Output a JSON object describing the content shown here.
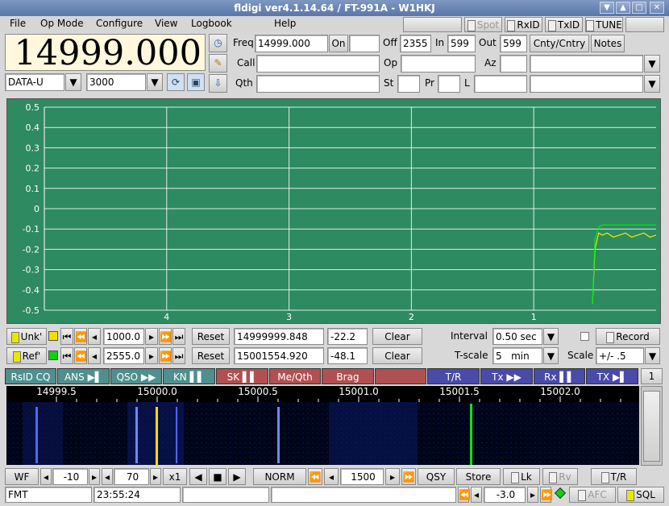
{
  "window": {
    "title": "fldigi ver4.1.14.64 / FT-991A - W1HKJ",
    "buttons": [
      "▼",
      "▲",
      "□",
      "✕"
    ]
  },
  "menu": [
    "File",
    "Op Mode",
    "Configure",
    "View",
    "Logbook",
    "Help"
  ],
  "status_buttons": {
    "spot": "Spot",
    "rxid": "RxID",
    "txid": "TxID",
    "tune": "TUNE"
  },
  "freq_display": "14999.000",
  "mode": "DATA-U",
  "bandwidth": "3000",
  "log": {
    "freq_label": "Freq",
    "freq": "14999.000",
    "on_label": "On",
    "on_value": "",
    "off_label": "Off",
    "off": "2355",
    "in_label": "In",
    "in": "599",
    "out_label": "Out",
    "out": "599",
    "cnty_label": "Cnty/Cntry",
    "notes_label": "Notes",
    "call_label": "Call",
    "call": "",
    "op_label": "Op",
    "op": "",
    "az_label": "Az",
    "az": "",
    "qth_label": "Qth",
    "qth": "",
    "st_label": "St",
    "st": "",
    "pr_label": "Pr",
    "pr": "",
    "l_label": "L",
    "l": ""
  },
  "chart_data": {
    "type": "line",
    "yticks": [
      "0.5",
      "0.4",
      "0.3",
      "0.2",
      "0.1",
      "0",
      "-0.1",
      "-0.2",
      "-0.3",
      "-0.4",
      "-0.5"
    ],
    "xticks": [
      "4",
      "3",
      "2",
      "1"
    ],
    "ylim": [
      -0.5,
      0.5
    ],
    "xlim": [
      5,
      0
    ],
    "grid": true,
    "series": [
      {
        "color": "#e0f000",
        "x": [
          0.52,
          0.5,
          0.47,
          0.44,
          0.4,
          0.35,
          0.3,
          0.25,
          0.2,
          0.15,
          0.1,
          0.05,
          0.0
        ],
        "y": [
          -0.47,
          -0.2,
          -0.12,
          -0.13,
          -0.12,
          -0.14,
          -0.13,
          -0.12,
          -0.14,
          -0.13,
          -0.12,
          -0.14,
          -0.13
        ]
      },
      {
        "color": "#00f000",
        "x": [
          0.52,
          0.5,
          0.47,
          0.44,
          0.4,
          0.3,
          0.2,
          0.1,
          0.0
        ],
        "y": [
          -0.47,
          -0.15,
          -0.09,
          -0.08,
          -0.08,
          -0.08,
          -0.08,
          -0.08,
          -0.08
        ]
      }
    ]
  },
  "row1": {
    "unk_label": "Unk'",
    "value": "1000.0",
    "reset": "Reset",
    "freq": "14999999.848",
    "db": "-22.2",
    "clear": "Clear",
    "interval_label": "Interval",
    "interval": "0.50 sec",
    "record": "Record"
  },
  "row2": {
    "ref_label": "Ref'",
    "value": "2555.0",
    "reset": "Reset",
    "freq": "15001554.920",
    "db": "-48.1",
    "clear": "Clear",
    "tscale_label": "T-scale",
    "tscale": "5   min",
    "scale_label": "Scale",
    "scale": "+/- .5"
  },
  "macros": [
    {
      "label": "RsID CQ",
      "color": "#4f8f8f"
    },
    {
      "label": "ANS ▶▌",
      "color": "#4f8f8f"
    },
    {
      "label": "QSO ▶▶",
      "color": "#4f8f8f"
    },
    {
      "label": "KN ▌▌",
      "color": "#4f8f8f"
    },
    {
      "label": "SK ▌▌",
      "color": "#b05050"
    },
    {
      "label": "Me/Qth",
      "color": "#b05050"
    },
    {
      "label": "Brag",
      "color": "#b05050"
    },
    {
      "label": "",
      "color": "#b05050"
    },
    {
      "label": "T/R",
      "color": "#4a4aa8"
    },
    {
      "label": "Tx ▶▶",
      "color": "#4a4aa8"
    },
    {
      "label": "Rx ▌▌",
      "color": "#4a4aa8"
    },
    {
      "label": "TX ▶▌",
      "color": "#4a4aa8"
    }
  ],
  "macro_bank": "1",
  "waterfall": {
    "ticks": [
      "14999.5",
      "15000.0",
      "15000.5",
      "15001.0",
      "15001.5",
      "15002.0"
    ]
  },
  "wf_controls": {
    "wf": "WF",
    "level": "-10",
    "range": "70",
    "zoom": "x1",
    "norm": "NORM",
    "carrier": "1500",
    "qsy": "QSY",
    "store": "Store",
    "lk": "Lk",
    "rv": "Rv",
    "tr": "T/R"
  },
  "status": {
    "mode": "FMT",
    "time": "23:55:24",
    "sql_level": "-3.0",
    "afc": "AFC",
    "sql": "SQL"
  }
}
